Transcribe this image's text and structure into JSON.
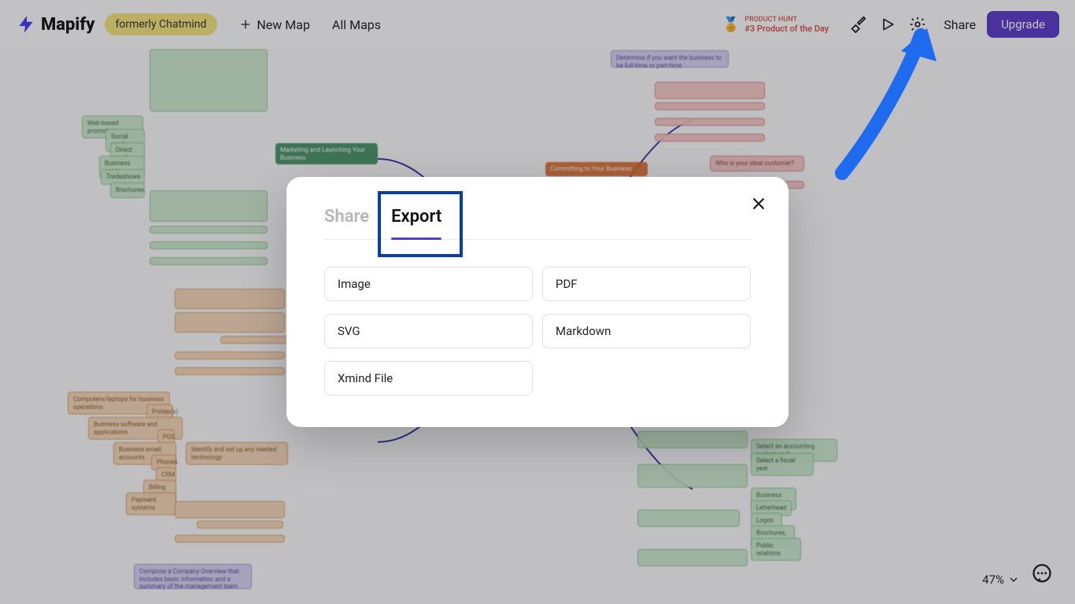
{
  "brand": {
    "name": "Mapify",
    "formerly": "formerly Chatmind"
  },
  "header": {
    "new_map": "New Map",
    "all_maps": "All Maps",
    "product_hunt_top": "PRODUCT HUNT",
    "product_hunt": "#3 Product of the Day",
    "share": "Share",
    "upgrade": "Upgrade"
  },
  "modal": {
    "tabs": {
      "share": "Share",
      "export": "Export",
      "active": "export"
    },
    "export_options": [
      "Image",
      "PDF",
      "SVG",
      "Markdown",
      "Xmind File"
    ]
  },
  "footer": {
    "zoom": "47%"
  },
  "mindmap_nodes": {
    "left_green_header": "Marketing and Launching Your Business",
    "right_orange_header": "Committing to Your Business",
    "sample_green": [
      "Web-based promotion",
      "Social media",
      "Direct mail",
      "Business cards",
      "Tradeshows",
      "Brochures"
    ],
    "sample_orange": [
      "Computers/laptops for business operations",
      "Printer(s)",
      "Business software and applications",
      "POS",
      "Business email accounts",
      "Phones",
      "CRM",
      "Billing and",
      "Payment systems"
    ],
    "sample_right_green": [
      "Select an accounting system and",
      "Select a fiscal year",
      "Business cards",
      "Letterhead",
      "Logos",
      "Brochures, or",
      "Public relations"
    ]
  }
}
